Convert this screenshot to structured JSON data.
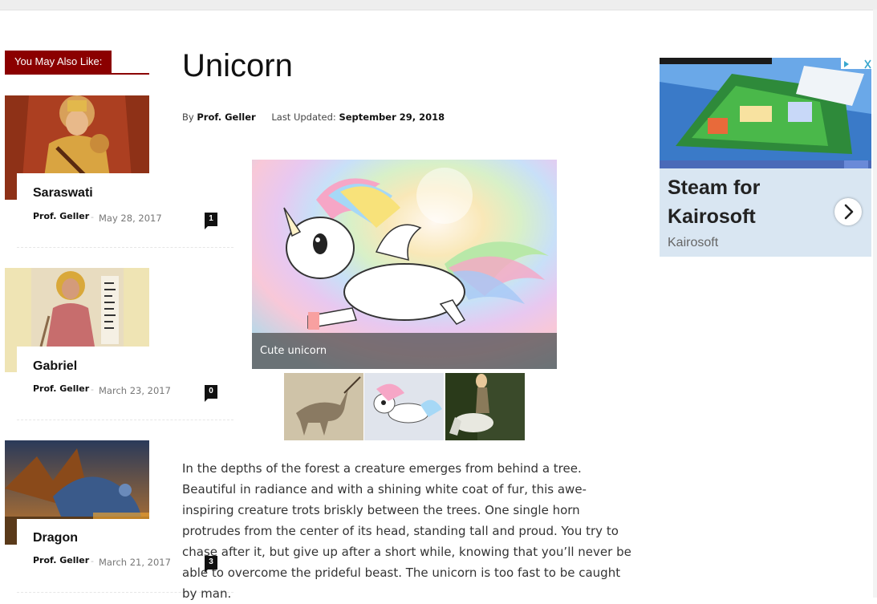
{
  "sidebar": {
    "heading": "You May Also Like:",
    "posts": [
      {
        "title": "Saraswati",
        "author": "Prof. Geller",
        "date": "May 28, 2017",
        "comments": "1"
      },
      {
        "title": "Gabriel",
        "author": "Prof. Geller",
        "date": "March 23, 2017",
        "comments": "0"
      },
      {
        "title": "Dragon",
        "author": "Prof. Geller",
        "date": "March 21, 2017",
        "comments": "3"
      }
    ],
    "separator": "-"
  },
  "article": {
    "title": "Unicorn",
    "by_label": "By",
    "author": "Prof. Geller",
    "updated_label": "Last Updated:",
    "updated_date": "September 29, 2018",
    "gallery": {
      "caption": "Cute unicorn",
      "thumbnails": [
        "unicorn-sketch-thumbnail",
        "cartoon-unicorn-thumbnail",
        "rider-on-white-horse-thumbnail"
      ]
    },
    "body": "In the depths of the forest a creature emerges from behind a tree. Beautiful in radiance and with a shining white coat of fur, this awe-inspiring creature trots briskly between the trees. One single horn protrudes from the center of its head, standing tall and proud. You try to chase after it, but give up after a short while, knowing that you’ll never be able to overcome the prideful beast. The unicorn is too fast to be caught by man."
  },
  "ad": {
    "headline": "Steam for Kairosoft",
    "advertiser": "Kairosoft",
    "icons": [
      "ad-choices-icon",
      "close-icon",
      "chevron-right-icon"
    ]
  },
  "colors": {
    "accent": "#8b0000",
    "ad_bg": "#d9e6f2"
  }
}
